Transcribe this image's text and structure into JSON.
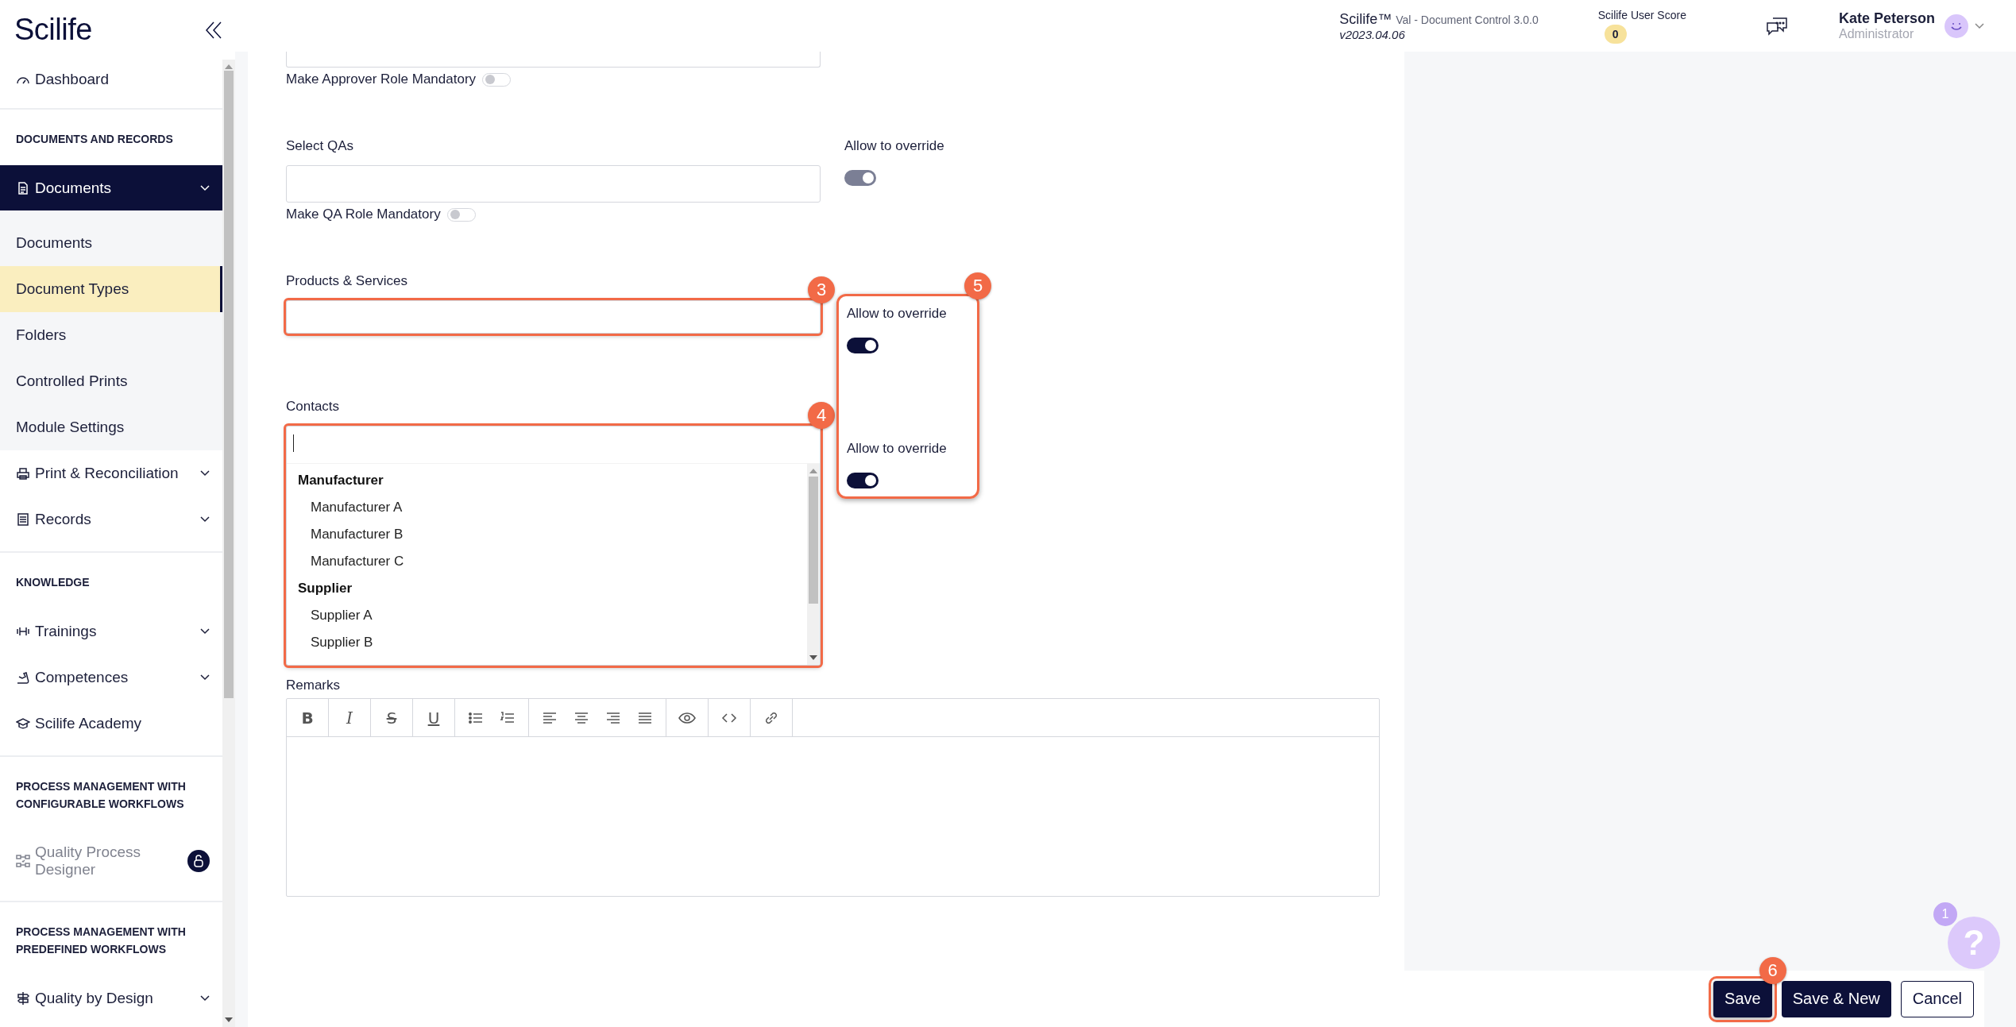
{
  "sidebar": {
    "logo": "Scilife",
    "items": [
      {
        "kind": "link",
        "label": "Dashboard"
      },
      {
        "kind": "section",
        "label": "DOCUMENTS AND RECORDS"
      },
      {
        "kind": "group",
        "label": "Documents",
        "expanded": true,
        "children": [
          {
            "label": "Documents",
            "selected": false
          },
          {
            "label": "Document Types",
            "selected": true
          },
          {
            "label": "Folders",
            "selected": false
          },
          {
            "label": "Controlled Prints",
            "selected": false
          },
          {
            "label": "Module Settings",
            "selected": false
          }
        ]
      },
      {
        "kind": "group",
        "label": "Print & Reconciliation",
        "expanded": false
      },
      {
        "kind": "group",
        "label": "Records",
        "expanded": false
      },
      {
        "kind": "section",
        "label": "KNOWLEDGE"
      },
      {
        "kind": "group",
        "label": "Trainings",
        "expanded": false
      },
      {
        "kind": "group",
        "label": "Competences",
        "expanded": false
      },
      {
        "kind": "link",
        "label": "Scilife Academy"
      },
      {
        "kind": "section",
        "label": "PROCESS MANAGEMENT WITH CONFIGURABLE WORKFLOWS"
      },
      {
        "kind": "link",
        "label": "Quality Process Designer",
        "locked": true
      },
      {
        "kind": "section",
        "label": "PROCESS MANAGEMENT WITH PREDEFINED WORKFLOWS"
      },
      {
        "kind": "group",
        "label": "Quality by Design",
        "expanded": false
      }
    ]
  },
  "header": {
    "product": "Scilife™",
    "module": "Val - Document Control 3.0.0",
    "version": "v2023.04.06",
    "score_label": "Scilife User Score",
    "score": "0",
    "user_name": "Kate Peterson",
    "user_role": "Administrator"
  },
  "form": {
    "rows": [
      {
        "kind": "clipped_input",
        "mandatory": {
          "label": "Make Approver Role Mandatory",
          "on": false
        }
      },
      {
        "kind": "input",
        "label": "Select QAs",
        "mandatory": {
          "label": "Make QA Role Mandatory",
          "on": false
        },
        "override": {
          "label": "Allow to override",
          "on": true,
          "disabled": true,
          "boxed": false
        }
      },
      {
        "kind": "input",
        "label": "Products & Services",
        "callout": "3",
        "override": {
          "label": "Allow to override",
          "on": true,
          "disabled": false,
          "boxed": true
        }
      },
      {
        "kind": "dropdown",
        "label": "Contacts",
        "callout": "4",
        "options": [
          {
            "label": "Manufacturer",
            "children": [
              "Manufacturer A",
              "Manufacturer B",
              "Manufacturer C"
            ]
          },
          {
            "label": "Supplier",
            "children": [
              "Supplier A",
              "Supplier B"
            ]
          }
        ],
        "override": {
          "label": "Allow to override",
          "on": true,
          "disabled": false,
          "boxed": true
        }
      }
    ],
    "override_box": {
      "callout": "5"
    },
    "remarks": {
      "label": "Remarks",
      "toolbar": [
        [
          {
            "kind": "bold",
            "text": "B"
          }
        ],
        [
          {
            "kind": "italic",
            "text": "I"
          }
        ],
        [
          {
            "kind": "strike",
            "text": "S"
          }
        ],
        [
          {
            "kind": "underline",
            "text": "U"
          }
        ],
        [
          {
            "kind": "bullets"
          },
          {
            "kind": "numbers"
          }
        ],
        [
          {
            "kind": "align_left"
          },
          {
            "kind": "align_center"
          },
          {
            "kind": "align_right"
          },
          {
            "kind": "justify"
          }
        ],
        [
          {
            "kind": "preview"
          }
        ],
        [
          {
            "kind": "code"
          }
        ],
        [
          {
            "kind": "link"
          }
        ]
      ]
    }
  },
  "footer": {
    "buttons": [
      {
        "label": "Save",
        "kind": "primary",
        "callout": "6"
      },
      {
        "label": "Save & New",
        "kind": "primary"
      },
      {
        "label": "Cancel",
        "kind": "secondary"
      }
    ]
  },
  "help": {
    "count": "1",
    "text": "?"
  }
}
